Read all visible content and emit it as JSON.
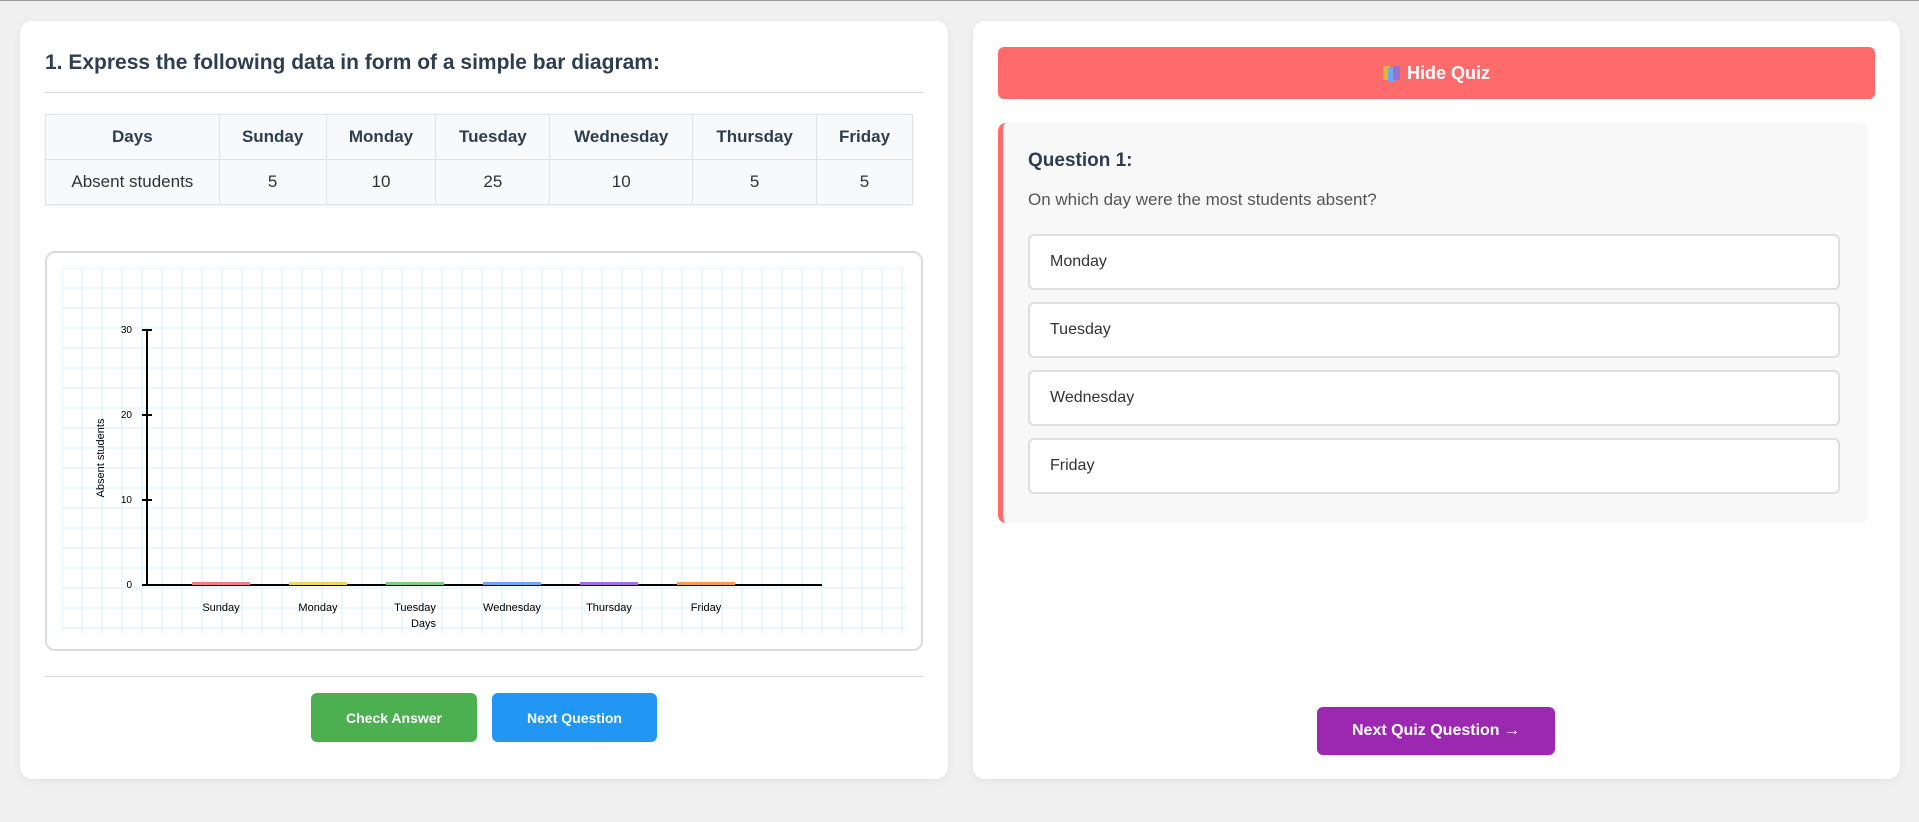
{
  "question": {
    "title": "1. Express the following data in form of a simple bar diagram:",
    "table": {
      "headers": [
        "Days",
        "Sunday",
        "Monday",
        "Tuesday",
        "Wednesday",
        "Thursday",
        "Friday"
      ],
      "row_label": "Absent students",
      "values": [
        "5",
        "10",
        "25",
        "10",
        "5",
        "5"
      ]
    }
  },
  "chart_data": {
    "type": "bar",
    "categories": [
      "Sunday",
      "Monday",
      "Tuesday",
      "Wednesday",
      "Thursday",
      "Friday"
    ],
    "values": [
      0,
      0,
      0,
      0,
      0,
      0
    ],
    "xlabel": "Days",
    "ylabel": "Absent students",
    "ylim": [
      0,
      30
    ],
    "yticks": [
      0,
      10,
      20,
      30
    ],
    "grid": true,
    "bar_colors": [
      "#f08080",
      "#f4d35e",
      "#7ccf7c",
      "#6fa8f0",
      "#a56de2",
      "#f0a050"
    ],
    "grid_color": "#d9ecfb"
  },
  "buttons": {
    "check_answer": "Check Answer",
    "next_question": "Next Question"
  },
  "quiz": {
    "hide_label": "Hide Quiz",
    "question_title": "Question 1:",
    "question_text": "On which day were the most students absent?",
    "options": [
      "Monday",
      "Tuesday",
      "Wednesday",
      "Friday"
    ],
    "next_label": "Next Quiz Question →"
  },
  "colors": {
    "hide_button": "#ff6b6b",
    "check_button": "#4caf50",
    "next_button": "#2196f3",
    "next_quiz_button": "#9c27b0"
  }
}
